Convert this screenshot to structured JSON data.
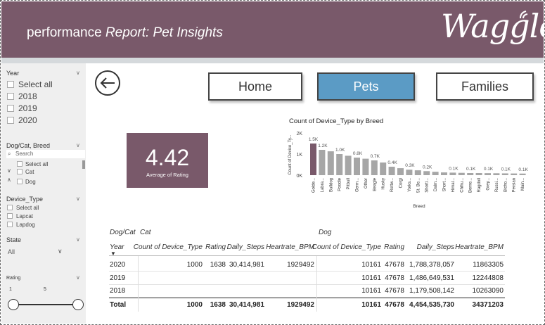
{
  "header": {
    "title_prefix": "performance ",
    "title_italic": "Report: Pet Insights",
    "logo_text": "Waggle",
    "bg_color": "#79596a"
  },
  "nav": {
    "home": "Home",
    "pets": "Pets",
    "families": "Families",
    "active_color": "#5b9bc5"
  },
  "sidebar": {
    "year": {
      "title": "Year",
      "items": [
        "Select all",
        "2018",
        "2019",
        "2020"
      ]
    },
    "dogcat": {
      "title": "Dog/Cat, Breed",
      "search_placeholder": "Search",
      "items": [
        "Select all",
        "Cat",
        "Dog"
      ]
    },
    "device": {
      "title": "Device_Type",
      "items": [
        "Select all",
        "Lapcat",
        "Lapdog"
      ]
    },
    "state": {
      "title": "State",
      "value": "All"
    },
    "rating": {
      "title": "Rating",
      "min": "1",
      "max": "5"
    }
  },
  "kpi": {
    "value": "4.42",
    "label": "Average of Rating"
  },
  "chart_data": {
    "type": "bar",
    "title": "Count of Device_Type by Breed",
    "xlabel": "Breed",
    "ylabel": "Count of Device_Ty...",
    "yticks": [
      "2K",
      "1K",
      "0K"
    ],
    "ylim": [
      0,
      2000
    ],
    "categories": [
      "Golde...",
      "Labra...",
      "Bulldog",
      "Poodle",
      "Pitbull",
      "Germ...",
      "Other",
      "Beagle",
      "Husky",
      "Rottw...",
      "Corgi",
      "Yorks...",
      "St. Be...",
      "Shorti...",
      "Dalm...",
      "Short...",
      "Himal...",
      "Chihu...",
      "Berne...",
      "Ragdoll",
      "Grey...",
      "Russi...",
      "Bicho...",
      "Persian",
      "Main..."
    ],
    "values": [
      1500,
      1200,
      1130,
      1000,
      920,
      830,
      780,
      700,
      600,
      400,
      330,
      260,
      230,
      190,
      160,
      130,
      120,
      110,
      100,
      100,
      95,
      90,
      85,
      80,
      75
    ],
    "data_labels": [
      "1.5K",
      "1.2K",
      "",
      "1.0K",
      "",
      "0.8K",
      "",
      "0.7K",
      "",
      "0.4K",
      "",
      "0.3K",
      "",
      "0.2K",
      "",
      "",
      "0.1K",
      "",
      "0.1K",
      "",
      "0.1K",
      "",
      "0.1K",
      "",
      "0.1K"
    ],
    "highlight_color": "#79596a",
    "bar_color": "#a6a6a6"
  },
  "table": {
    "group_header_label": "Dog/Cat",
    "groups": [
      "Cat",
      "Dog"
    ],
    "row_header": "Year",
    "columns": [
      "Count of Device_Type",
      "Rating",
      "Daily_Steps",
      "Heartrate_BPM"
    ],
    "rows": [
      {
        "year": "2020",
        "cat": [
          "1000",
          "1638",
          "30,414,981",
          "1929492"
        ],
        "dog": [
          "10161",
          "47678",
          "1,788,378,057",
          "11863305"
        ]
      },
      {
        "year": "2019",
        "cat": [
          "",
          "",
          "",
          ""
        ],
        "dog": [
          "10161",
          "47678",
          "1,486,649,531",
          "12244808"
        ]
      },
      {
        "year": "2018",
        "cat": [
          "",
          "",
          "",
          ""
        ],
        "dog": [
          "10161",
          "47678",
          "1,179,508,142",
          "10263090"
        ]
      }
    ],
    "total": {
      "label": "Total",
      "cat": [
        "1000",
        "1638",
        "30,414,981",
        "1929492"
      ],
      "dog": [
        "10161",
        "47678",
        "4,454,535,730",
        "34371203"
      ]
    }
  }
}
